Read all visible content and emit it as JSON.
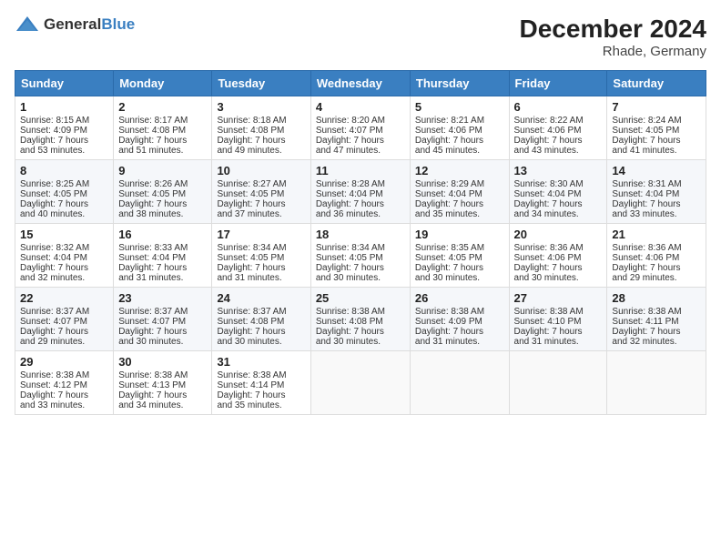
{
  "logo": {
    "text_general": "General",
    "text_blue": "Blue"
  },
  "title": "December 2024",
  "subtitle": "Rhade, Germany",
  "days_of_week": [
    "Sunday",
    "Monday",
    "Tuesday",
    "Wednesday",
    "Thursday",
    "Friday",
    "Saturday"
  ],
  "weeks": [
    [
      {
        "day": 1,
        "lines": [
          "Sunrise: 8:15 AM",
          "Sunset: 4:09 PM",
          "Daylight: 7 hours",
          "and 53 minutes."
        ]
      },
      {
        "day": 2,
        "lines": [
          "Sunrise: 8:17 AM",
          "Sunset: 4:08 PM",
          "Daylight: 7 hours",
          "and 51 minutes."
        ]
      },
      {
        "day": 3,
        "lines": [
          "Sunrise: 8:18 AM",
          "Sunset: 4:08 PM",
          "Daylight: 7 hours",
          "and 49 minutes."
        ]
      },
      {
        "day": 4,
        "lines": [
          "Sunrise: 8:20 AM",
          "Sunset: 4:07 PM",
          "Daylight: 7 hours",
          "and 47 minutes."
        ]
      },
      {
        "day": 5,
        "lines": [
          "Sunrise: 8:21 AM",
          "Sunset: 4:06 PM",
          "Daylight: 7 hours",
          "and 45 minutes."
        ]
      },
      {
        "day": 6,
        "lines": [
          "Sunrise: 8:22 AM",
          "Sunset: 4:06 PM",
          "Daylight: 7 hours",
          "and 43 minutes."
        ]
      },
      {
        "day": 7,
        "lines": [
          "Sunrise: 8:24 AM",
          "Sunset: 4:05 PM",
          "Daylight: 7 hours",
          "and 41 minutes."
        ]
      }
    ],
    [
      {
        "day": 8,
        "lines": [
          "Sunrise: 8:25 AM",
          "Sunset: 4:05 PM",
          "Daylight: 7 hours",
          "and 40 minutes."
        ]
      },
      {
        "day": 9,
        "lines": [
          "Sunrise: 8:26 AM",
          "Sunset: 4:05 PM",
          "Daylight: 7 hours",
          "and 38 minutes."
        ]
      },
      {
        "day": 10,
        "lines": [
          "Sunrise: 8:27 AM",
          "Sunset: 4:05 PM",
          "Daylight: 7 hours",
          "and 37 minutes."
        ]
      },
      {
        "day": 11,
        "lines": [
          "Sunrise: 8:28 AM",
          "Sunset: 4:04 PM",
          "Daylight: 7 hours",
          "and 36 minutes."
        ]
      },
      {
        "day": 12,
        "lines": [
          "Sunrise: 8:29 AM",
          "Sunset: 4:04 PM",
          "Daylight: 7 hours",
          "and 35 minutes."
        ]
      },
      {
        "day": 13,
        "lines": [
          "Sunrise: 8:30 AM",
          "Sunset: 4:04 PM",
          "Daylight: 7 hours",
          "and 34 minutes."
        ]
      },
      {
        "day": 14,
        "lines": [
          "Sunrise: 8:31 AM",
          "Sunset: 4:04 PM",
          "Daylight: 7 hours",
          "and 33 minutes."
        ]
      }
    ],
    [
      {
        "day": 15,
        "lines": [
          "Sunrise: 8:32 AM",
          "Sunset: 4:04 PM",
          "Daylight: 7 hours",
          "and 32 minutes."
        ]
      },
      {
        "day": 16,
        "lines": [
          "Sunrise: 8:33 AM",
          "Sunset: 4:04 PM",
          "Daylight: 7 hours",
          "and 31 minutes."
        ]
      },
      {
        "day": 17,
        "lines": [
          "Sunrise: 8:34 AM",
          "Sunset: 4:05 PM",
          "Daylight: 7 hours",
          "and 31 minutes."
        ]
      },
      {
        "day": 18,
        "lines": [
          "Sunrise: 8:34 AM",
          "Sunset: 4:05 PM",
          "Daylight: 7 hours",
          "and 30 minutes."
        ]
      },
      {
        "day": 19,
        "lines": [
          "Sunrise: 8:35 AM",
          "Sunset: 4:05 PM",
          "Daylight: 7 hours",
          "and 30 minutes."
        ]
      },
      {
        "day": 20,
        "lines": [
          "Sunrise: 8:36 AM",
          "Sunset: 4:06 PM",
          "Daylight: 7 hours",
          "and 30 minutes."
        ]
      },
      {
        "day": 21,
        "lines": [
          "Sunrise: 8:36 AM",
          "Sunset: 4:06 PM",
          "Daylight: 7 hours",
          "and 29 minutes."
        ]
      }
    ],
    [
      {
        "day": 22,
        "lines": [
          "Sunrise: 8:37 AM",
          "Sunset: 4:07 PM",
          "Daylight: 7 hours",
          "and 29 minutes."
        ]
      },
      {
        "day": 23,
        "lines": [
          "Sunrise: 8:37 AM",
          "Sunset: 4:07 PM",
          "Daylight: 7 hours",
          "and 30 minutes."
        ]
      },
      {
        "day": 24,
        "lines": [
          "Sunrise: 8:37 AM",
          "Sunset: 4:08 PM",
          "Daylight: 7 hours",
          "and 30 minutes."
        ]
      },
      {
        "day": 25,
        "lines": [
          "Sunrise: 8:38 AM",
          "Sunset: 4:08 PM",
          "Daylight: 7 hours",
          "and 30 minutes."
        ]
      },
      {
        "day": 26,
        "lines": [
          "Sunrise: 8:38 AM",
          "Sunset: 4:09 PM",
          "Daylight: 7 hours",
          "and 31 minutes."
        ]
      },
      {
        "day": 27,
        "lines": [
          "Sunrise: 8:38 AM",
          "Sunset: 4:10 PM",
          "Daylight: 7 hours",
          "and 31 minutes."
        ]
      },
      {
        "day": 28,
        "lines": [
          "Sunrise: 8:38 AM",
          "Sunset: 4:11 PM",
          "Daylight: 7 hours",
          "and 32 minutes."
        ]
      }
    ],
    [
      {
        "day": 29,
        "lines": [
          "Sunrise: 8:38 AM",
          "Sunset: 4:12 PM",
          "Daylight: 7 hours",
          "and 33 minutes."
        ]
      },
      {
        "day": 30,
        "lines": [
          "Sunrise: 8:38 AM",
          "Sunset: 4:13 PM",
          "Daylight: 7 hours",
          "and 34 minutes."
        ]
      },
      {
        "day": 31,
        "lines": [
          "Sunrise: 8:38 AM",
          "Sunset: 4:14 PM",
          "Daylight: 7 hours",
          "and 35 minutes."
        ]
      },
      null,
      null,
      null,
      null
    ]
  ]
}
